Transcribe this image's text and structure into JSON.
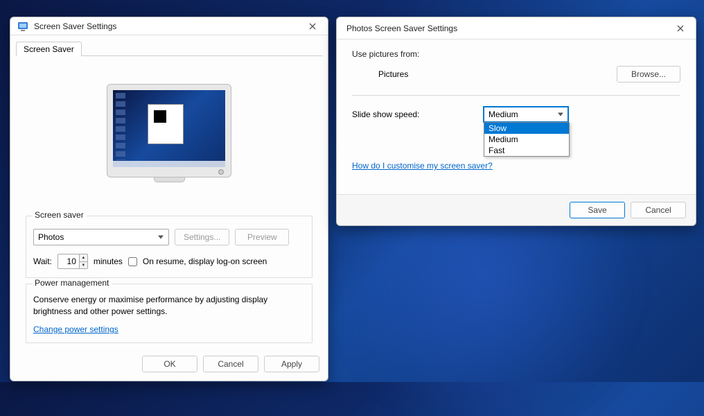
{
  "screenSaver": {
    "title": "Screen Saver Settings",
    "tab": "Screen Saver",
    "fieldsetLabel": "Screen saver",
    "selected": "Photos",
    "settingsBtn": "Settings...",
    "previewBtn": "Preview",
    "waitLabel": "Wait:",
    "waitValue": "10",
    "minutesLabel": "minutes",
    "resumeLabel": "On resume, display log-on screen",
    "power": {
      "legend": "Power management",
      "desc": "Conserve energy or maximise performance by adjusting display brightness and other power settings.",
      "link": "Change power settings"
    },
    "buttons": {
      "ok": "OK",
      "cancel": "Cancel",
      "apply": "Apply"
    }
  },
  "photos": {
    "title": "Photos Screen Saver Settings",
    "usePicturesLabel": "Use pictures from:",
    "picturesValue": "Pictures",
    "browseBtn": "Browse...",
    "speedLabel": "Slide show speed:",
    "speedSelected": "Medium",
    "options": [
      "Slow",
      "Medium",
      "Fast"
    ],
    "highlightedOption": "Slow",
    "customizeLink": "How do I customise my screen saver?",
    "buttons": {
      "save": "Save",
      "cancel": "Cancel"
    }
  }
}
